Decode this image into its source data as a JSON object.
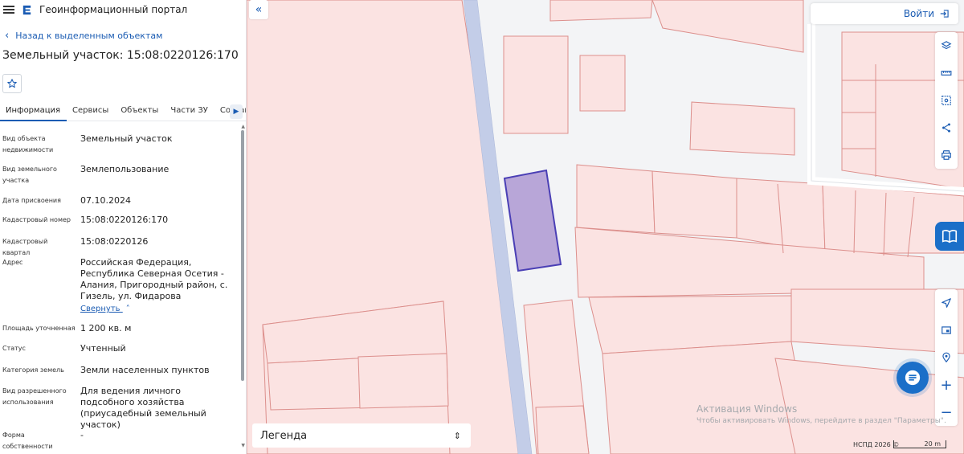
{
  "header": {
    "portal_title": "Геоинформационный портал"
  },
  "panel": {
    "back_label": "Назад к выделенным объектам",
    "object_title": "Земельный участок: 15:08:0220126:170",
    "tabs": [
      {
        "label": "Информация"
      },
      {
        "label": "Сервисы"
      },
      {
        "label": "Объекты"
      },
      {
        "label": "Части ЗУ"
      },
      {
        "label": "Состав"
      }
    ],
    "attributes": [
      {
        "label": "Вид объекта недвижимости",
        "value": "Земельный участок"
      },
      {
        "label": "Вид земельного участка",
        "value": "Землепользование"
      },
      {
        "label": "Дата присвоения",
        "value": "07.10.2024"
      },
      {
        "label": "Кадастровый номер",
        "value": "15:08:0220126:170"
      },
      {
        "label": "Кадастровый квартал",
        "value": "15:08:0220126"
      },
      {
        "label": "Адрес",
        "value": "Российская Федерация, Республика Северная Осетия - Алания, Пригородный район, с. Гизель, ул. Фидарова"
      },
      {
        "label": "Площадь уточненная",
        "value": "1 200 кв. м"
      },
      {
        "label": "Статус",
        "value": "Учтенный"
      },
      {
        "label": "Категория земель",
        "value": "Земли населенных пунктов"
      },
      {
        "label": "Вид разрешенного использования",
        "value": "Для ведения личного подсобного хозяйства (приусадебный земельный участок)"
      },
      {
        "label": "Форма собственности",
        "value": "-"
      }
    ],
    "collapse_label": "Свернуть"
  },
  "map": {
    "login_label": "Войти",
    "legend_label": "Легенда",
    "watermark_title": "Активация Windows",
    "watermark_text": "Чтобы активировать Windows, перейдите в раздел \"Параметры\".",
    "attribution": "НСПД 2026 ©",
    "scale_label": "20 m",
    "colors": {
      "parcel_fill": "#fbe3e2",
      "parcel_stroke": "#dc8f8c",
      "road": "#c3cde8",
      "selected_fill": "#b8a6d8",
      "selected_stroke": "#4a3fb5",
      "accent": "#1b5cb3"
    }
  }
}
